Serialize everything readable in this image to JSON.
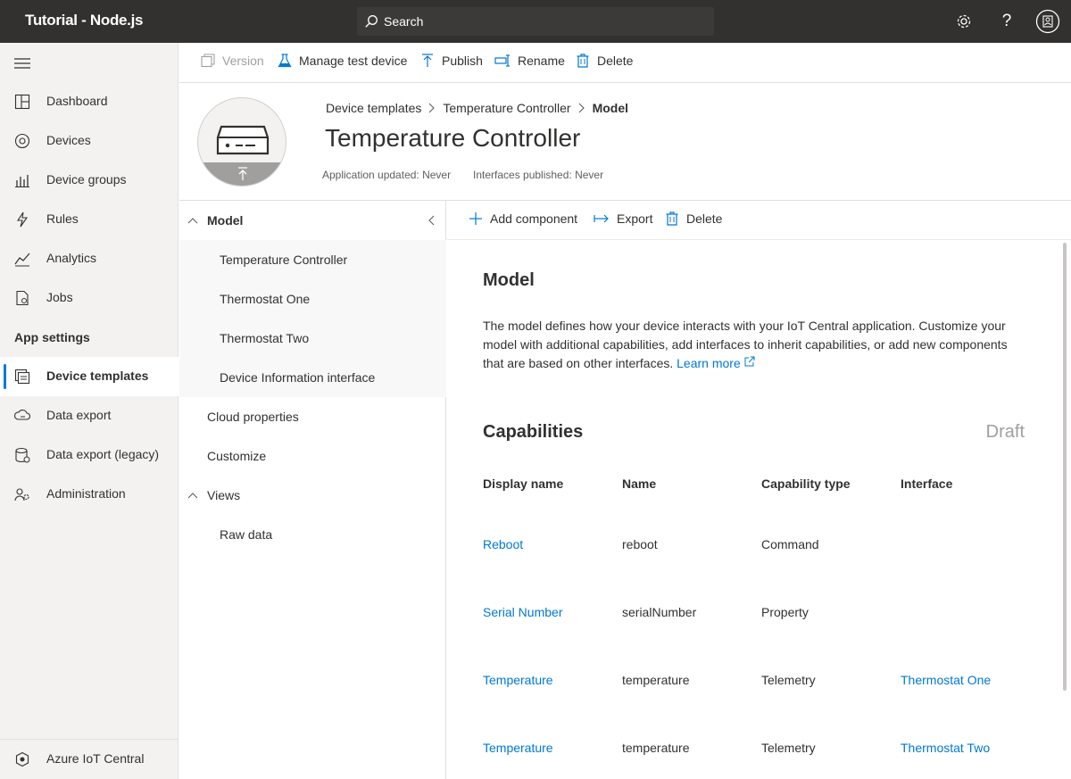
{
  "app": {
    "title": "Tutorial - Node.js"
  },
  "search": {
    "placeholder": "Search"
  },
  "topbar": {
    "icons": [
      "gear-icon",
      "help-icon",
      "account-icon"
    ],
    "help_glyph": "?"
  },
  "nav": {
    "items": [
      {
        "label": "Dashboard",
        "icon": "dashboard-icon"
      },
      {
        "label": "Devices",
        "icon": "devices-icon"
      },
      {
        "label": "Device groups",
        "icon": "device-groups-icon"
      },
      {
        "label": "Rules",
        "icon": "rules-icon"
      },
      {
        "label": "Analytics",
        "icon": "analytics-icon"
      },
      {
        "label": "Jobs",
        "icon": "jobs-icon"
      }
    ],
    "section": "App settings",
    "settings_items": [
      {
        "label": "Device templates",
        "icon": "device-templates-icon",
        "active": true
      },
      {
        "label": "Data export",
        "icon": "data-export-icon"
      },
      {
        "label": "Data export (legacy)",
        "icon": "data-export-legacy-icon"
      },
      {
        "label": "Administration",
        "icon": "administration-icon"
      }
    ],
    "footer": "Azure IoT Central"
  },
  "commands": {
    "version": "Version",
    "manage_test_device": "Manage test device",
    "publish": "Publish",
    "rename": "Rename",
    "delete": "Delete"
  },
  "breadcrumb": [
    "Device templates",
    "Temperature Controller",
    "Model"
  ],
  "page": {
    "title": "Temperature Controller",
    "app_updated": "Application updated: Never",
    "interfaces_published": "Interfaces published: Never"
  },
  "tree": {
    "model": "Model",
    "model_children": [
      "Temperature Controller",
      "Thermostat One",
      "Thermostat Two",
      "Device Information interface"
    ],
    "cloud_properties": "Cloud properties",
    "customize": "Customize",
    "views": "Views",
    "views_children": [
      "Raw data"
    ]
  },
  "content_toolbar": {
    "add_component": "Add component",
    "export": "Export",
    "delete": "Delete"
  },
  "model_section": {
    "heading": "Model",
    "description": "The model defines how your device interacts with your IoT Central application. Customize your model with additional capabilities, add interfaces to inherit capabilities, or add new components that are based on other interfaces.",
    "learn_more": "Learn more"
  },
  "capabilities": {
    "heading": "Capabilities",
    "status": "Draft",
    "columns": [
      "Display name",
      "Name",
      "Capability type",
      "Interface"
    ],
    "rows": [
      {
        "display_name": "Reboot",
        "name": "reboot",
        "type": "Command",
        "interface": ""
      },
      {
        "display_name": "Serial Number",
        "name": "serialNumber",
        "type": "Property",
        "interface": ""
      },
      {
        "display_name": "Temperature",
        "name": "temperature",
        "type": "Telemetry",
        "interface": "Thermostat One"
      },
      {
        "display_name": "Temperature",
        "name": "temperature",
        "type": "Telemetry",
        "interface": "Thermostat Two"
      }
    ]
  },
  "colors": {
    "accent": "#0078d4",
    "topbar": "#323130",
    "nav_bg": "#f3f2f1"
  }
}
